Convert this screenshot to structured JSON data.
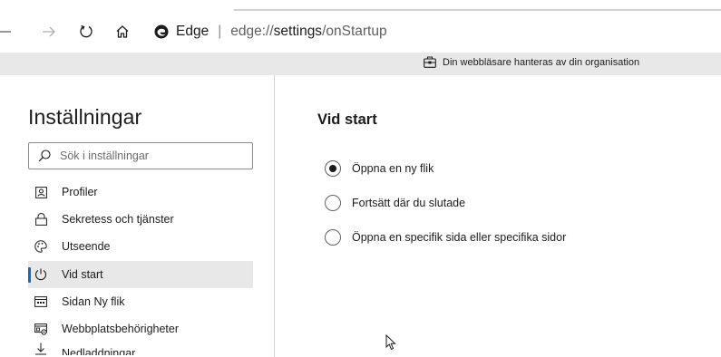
{
  "browser": {
    "site_label": "Edge",
    "url_prefix": "edge://",
    "url_bold": "settings",
    "url_rest": "/onStartup",
    "icons": [
      "back-arrow-icon",
      "forward-arrow-icon",
      "refresh-icon",
      "home-icon",
      "edge-logo"
    ]
  },
  "banner": {
    "icon": "briefcase-icon",
    "text": "Din webbläsare hanteras av din organisation"
  },
  "sidebar": {
    "title": "Inställningar",
    "search_placeholder": "Sök i inställningar",
    "items": [
      {
        "label": "Profiler",
        "icon": "profile-icon",
        "active": false
      },
      {
        "label": "Sekretess och tjänster",
        "icon": "lock-icon",
        "active": false
      },
      {
        "label": "Utseende",
        "icon": "palette-icon",
        "active": false
      },
      {
        "label": "Vid start",
        "icon": "power-icon",
        "active": true
      },
      {
        "label": "Sidan Ny flik",
        "icon": "newtab-icon",
        "active": false
      },
      {
        "label": "Webbplatsbehörigheter",
        "icon": "site-permissions-icon",
        "active": false
      },
      {
        "label": "Nedladdningar",
        "icon": "download-icon",
        "active": false
      }
    ]
  },
  "main": {
    "section_title": "Vid start",
    "options": [
      {
        "label": "Öppna en ny flik",
        "checked": true
      },
      {
        "label": "Fortsätt där du slutade",
        "checked": false
      },
      {
        "label": "Öppna en specifik sida eller specifika sidor",
        "checked": false
      }
    ]
  },
  "colors": {
    "accent": "#0f6cbd",
    "banner_bg": "#e8e8e8",
    "active_item_bg": "#e8e8e8"
  }
}
